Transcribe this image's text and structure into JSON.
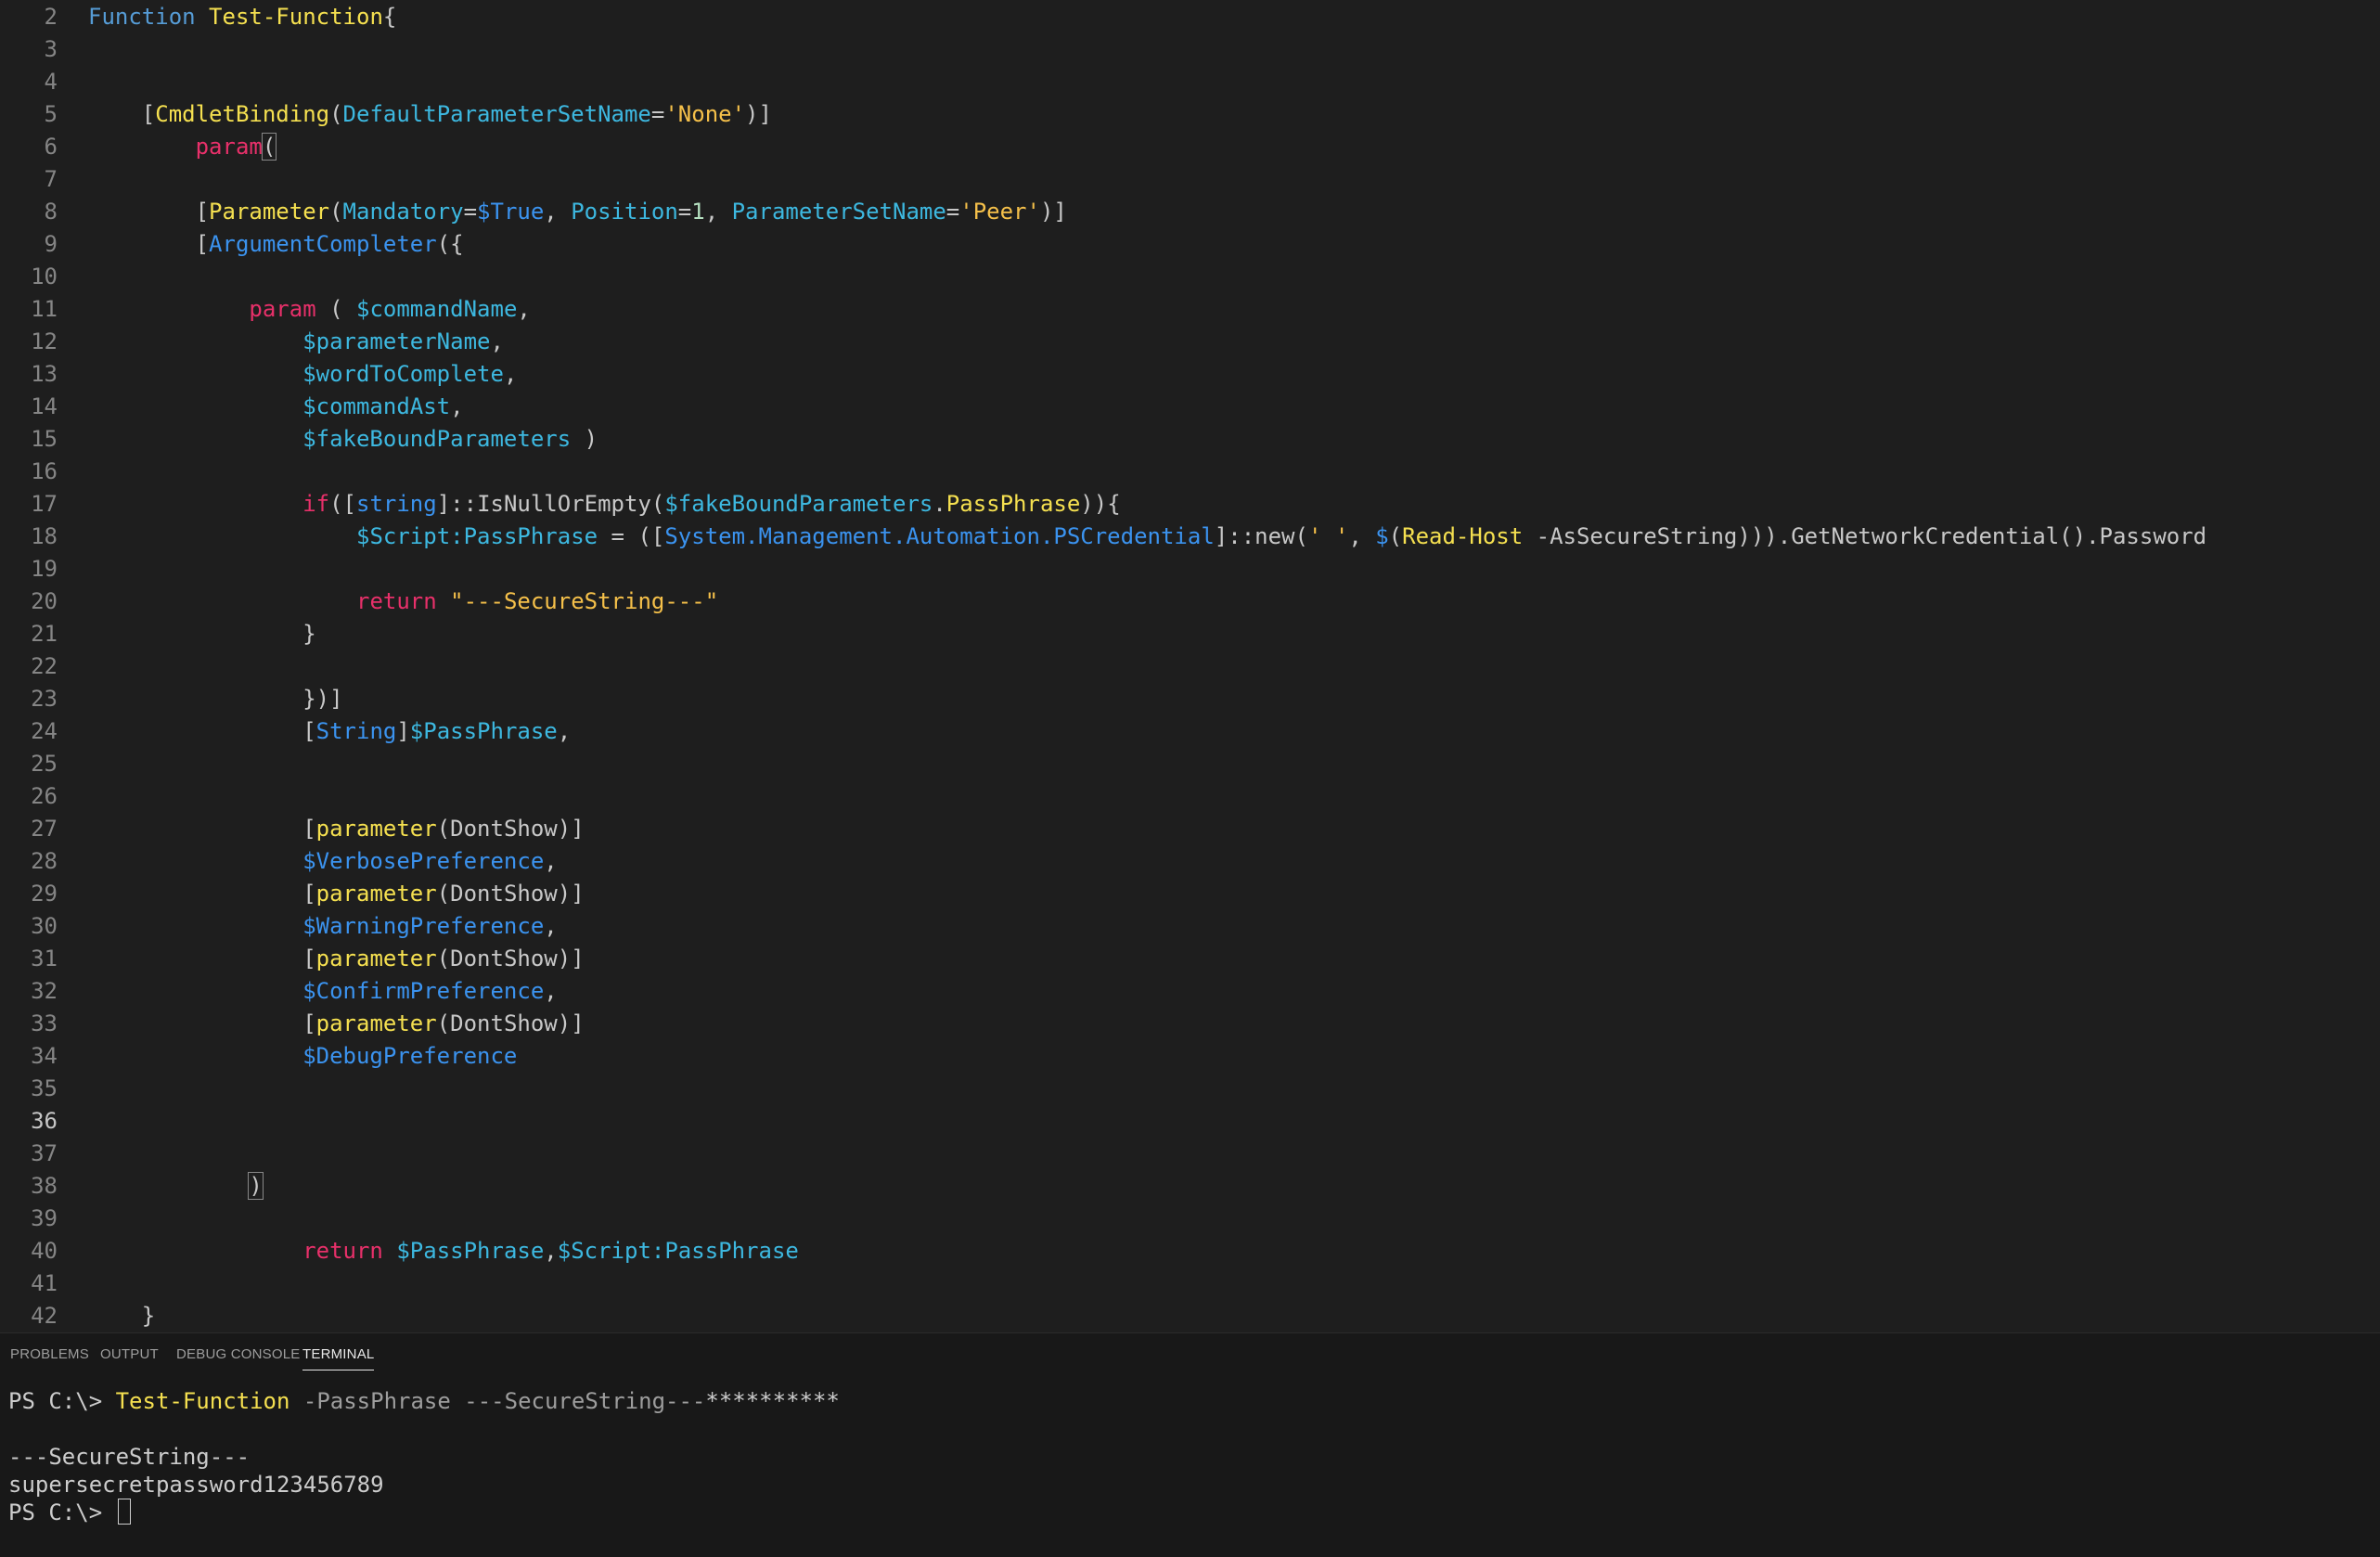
{
  "editor": {
    "lines": [
      {
        "n": "2",
        "code": "Function Test-Function{"
      },
      {
        "n": "3",
        "code": ""
      },
      {
        "n": "4",
        "code": ""
      },
      {
        "n": "5",
        "code": "[CmdletBinding(DefaultParameterSetName='None')]"
      },
      {
        "n": "6",
        "code": "param("
      },
      {
        "n": "7",
        "code": ""
      },
      {
        "n": "8",
        "code": "[Parameter(Mandatory=$True, Position=1, ParameterSetName='Peer')]"
      },
      {
        "n": "9",
        "code": "[ArgumentCompleter({"
      },
      {
        "n": "10",
        "code": ""
      },
      {
        "n": "11",
        "code": "param ( $commandName,"
      },
      {
        "n": "12",
        "code": "$parameterName,"
      },
      {
        "n": "13",
        "code": "$wordToComplete,"
      },
      {
        "n": "14",
        "code": "$commandAst,"
      },
      {
        "n": "15",
        "code": "$fakeBoundParameters )"
      },
      {
        "n": "16",
        "code": ""
      },
      {
        "n": "17",
        "code": "if([string]::IsNullOrEmpty($fakeBoundParameters.PassPhrase)){"
      },
      {
        "n": "18",
        "code": "$Script:PassPhrase = ([System.Management.Automation.PSCredential]::new(' ', $(Read-Host -AsSecureString))).GetNetworkCredential().Password"
      },
      {
        "n": "19",
        "code": ""
      },
      {
        "n": "20",
        "code": "return \"---SecureString---\""
      },
      {
        "n": "21",
        "code": "}"
      },
      {
        "n": "22",
        "code": ""
      },
      {
        "n": "23",
        "code": "})]"
      },
      {
        "n": "24",
        "code": "[String]$PassPhrase,"
      },
      {
        "n": "25",
        "code": ""
      },
      {
        "n": "26",
        "code": ""
      },
      {
        "n": "27",
        "code": "[parameter(DontShow)]"
      },
      {
        "n": "28",
        "code": "$VerbosePreference,"
      },
      {
        "n": "29",
        "code": "[parameter(DontShow)]"
      },
      {
        "n": "30",
        "code": "$WarningPreference,"
      },
      {
        "n": "31",
        "code": "[parameter(DontShow)]"
      },
      {
        "n": "32",
        "code": "$ConfirmPreference,"
      },
      {
        "n": "33",
        "code": "[parameter(DontShow)]"
      },
      {
        "n": "34",
        "code": "$DebugPreference"
      },
      {
        "n": "35",
        "code": ""
      },
      {
        "n": "36",
        "code": ""
      },
      {
        "n": "37",
        "code": ""
      },
      {
        "n": "38",
        "code": ")"
      },
      {
        "n": "39",
        "code": ""
      },
      {
        "n": "40",
        "code": "return $PassPhrase,$Script:PassPhrase"
      },
      {
        "n": "41",
        "code": ""
      },
      {
        "n": "42",
        "code": "}"
      }
    ],
    "active_line": "36"
  },
  "panel": {
    "tabs": [
      {
        "label": "PROBLEMS",
        "active": false
      },
      {
        "label": "OUTPUT",
        "active": false
      },
      {
        "label": "DEBUG CONSOLE",
        "active": false
      },
      {
        "label": "TERMINAL",
        "active": true
      }
    ]
  },
  "terminal": {
    "prompt": "PS C:\\> ",
    "command": "Test-Function",
    "args": " -PassPhrase ---SecureString---",
    "masked_input": "**********",
    "output_line_1": "---SecureString---",
    "output_line_2": "supersecretpassword123456789",
    "prompt_2": "PS C:\\> "
  },
  "colors": {
    "background": "#1e1e1e",
    "panel_background": "#181818",
    "keyword": "#569cd6",
    "control_keyword": "#e8306a",
    "function_name": "#f5e050",
    "variable": "#3db8e0",
    "string": "#f5c04a"
  }
}
